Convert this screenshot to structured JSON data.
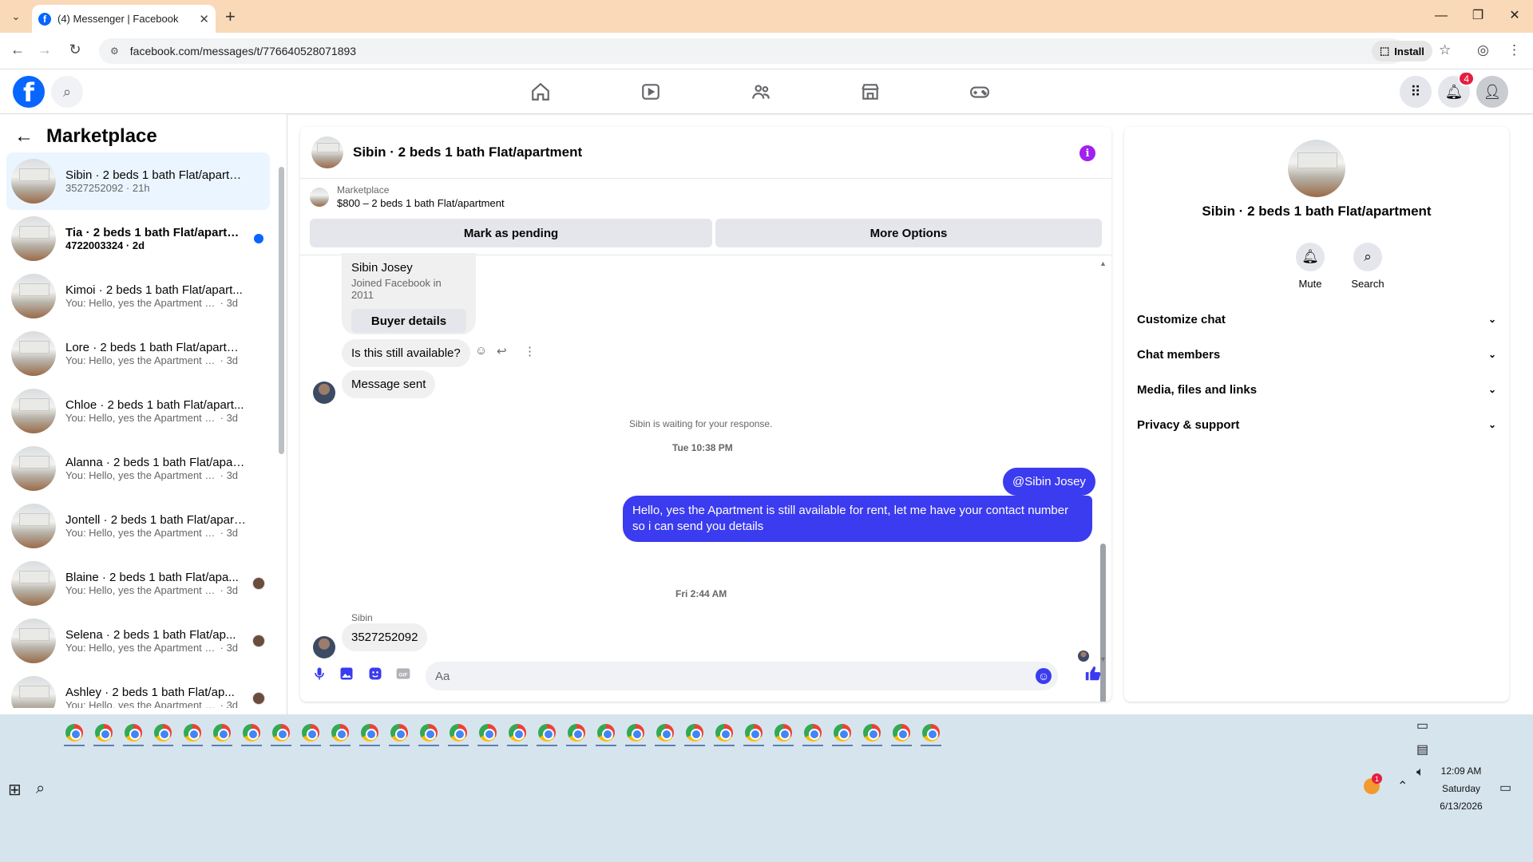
{
  "browser": {
    "tab_title": "(4) Messenger | Facebook",
    "url": "facebook.com/messages/t/776640528071893",
    "install_label": "Install"
  },
  "fb": {
    "notification_count": "4"
  },
  "sidebar": {
    "title": "Marketplace",
    "conversations": [
      {
        "name": "Sibin · 2 beds 1 bath Flat/apartm...",
        "snippet": "3527252092",
        "time": "21h",
        "active": true
      },
      {
        "name": "Tia · 2 beds 1 bath Flat/apartm...",
        "snippet": "4722003324",
        "time": "2d",
        "unread": true
      },
      {
        "name": "Kimoi · 2 beds 1 bath Flat/apart...",
        "snippet": "You: Hello, yes the Apartment is stil...",
        "time": "3d"
      },
      {
        "name": "Lore · 2 beds 1 bath Flat/apartm...",
        "snippet": "You: Hello, yes the Apartment is stil...",
        "time": "3d"
      },
      {
        "name": "Chloe · 2 beds 1 bath Flat/apart...",
        "snippet": "You: Hello, yes the Apartment is stil...",
        "time": "3d"
      },
      {
        "name": "Alanna · 2 beds 1 bath Flat/apart...",
        "snippet": "You: Hello, yes the Apartment is stil...",
        "time": "3d"
      },
      {
        "name": "Jontell · 2 beds 1 bath Flat/apart...",
        "snippet": "You: Hello, yes the Apartment is stil...",
        "time": "3d"
      },
      {
        "name": "Blaine · 2 beds 1 bath Flat/apa...",
        "snippet": "You: Hello, yes the Apartment is ...",
        "time": "3d"
      },
      {
        "name": "Selena · 2 beds 1 bath Flat/ap...",
        "snippet": "You: Hello, yes the Apartment is ...",
        "time": "3d"
      },
      {
        "name": "Ashley · 2 beds 1 bath Flat/ap...",
        "snippet": "You: Hello, yes the Apartment is ...",
        "time": "3d"
      }
    ]
  },
  "chat": {
    "title": "Sibin · 2 beds 1 bath Flat/apartment",
    "marketplace_label": "Marketplace",
    "listing": "$800 – 2 beds 1 bath Flat/apartment",
    "mark_pending": "Mark as pending",
    "more_options": "More Options",
    "buyer_name": "Sibin Josey",
    "buyer_joined": "Joined Facebook in 2011",
    "buyer_details": "Buyer details",
    "msg_available": "Is this still available?",
    "msg_sent": "Message sent",
    "waiting": "Sibin is waiting for your response.",
    "ts1": "Tue 10:38 PM",
    "mention": "@Sibin Josey",
    "reply": "Hello, yes the Apartment is still available for rent, let me have your contact number so i can send you details",
    "ts2": "Fri 2:44 AM",
    "sender_label": "Sibin",
    "phone_msg": "3527252092",
    "composer_placeholder": "Aa",
    "accent": "#3b3bf0"
  },
  "info_panel": {
    "title": "Sibin · 2 beds 1 bath Flat/apartment",
    "mute": "Mute",
    "search": "Search",
    "sections": [
      "Customize chat",
      "Chat members",
      "Media, files and links",
      "Privacy & support"
    ]
  },
  "taskbar": {
    "time": "12:09 AM",
    "day": "Saturday",
    "date": "6/13/2026",
    "tray_badge": "1"
  }
}
